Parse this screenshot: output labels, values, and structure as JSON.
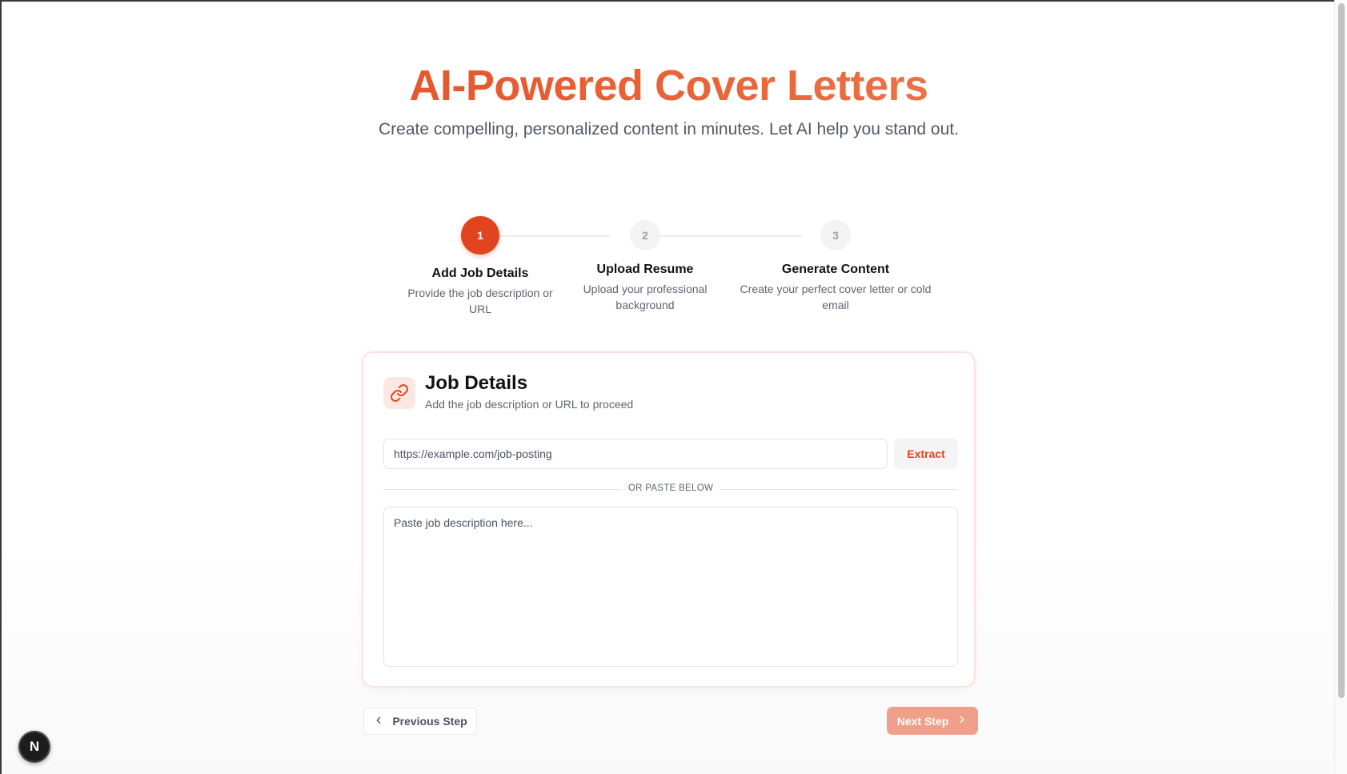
{
  "hero": {
    "title": "AI-Powered Cover Letters",
    "subtitle": "Create compelling, personalized content in minutes. Let AI help you stand out."
  },
  "steps": [
    {
      "number": "1",
      "title": "Add Job Details",
      "description": "Provide the job description or URL",
      "state": "active"
    },
    {
      "number": "2",
      "title": "Upload Resume",
      "description": "Upload your professional background",
      "state": "inactive"
    },
    {
      "number": "3",
      "title": "Generate Content",
      "description": "Create your perfect cover letter or cold email",
      "state": "inactive"
    }
  ],
  "card": {
    "icon": "link-icon",
    "title": "Job Details",
    "subtitle": "Add the job description or URL to proceed",
    "url_placeholder": "https://example.com/job-posting",
    "url_value": "",
    "extract_label": "Extract",
    "divider_label": "OR PASTE BELOW",
    "paste_placeholder": "Paste job description here...",
    "paste_value": ""
  },
  "nav": {
    "prev_label": "Previous Step",
    "next_label": "Next Step",
    "next_enabled": false
  },
  "dev_badge": {
    "label": "N",
    "icon": "nextjs-icon"
  },
  "colors": {
    "accent": "#e2441f",
    "accent_light": "#f0a08a",
    "icon_bg": "#fde7e2"
  }
}
